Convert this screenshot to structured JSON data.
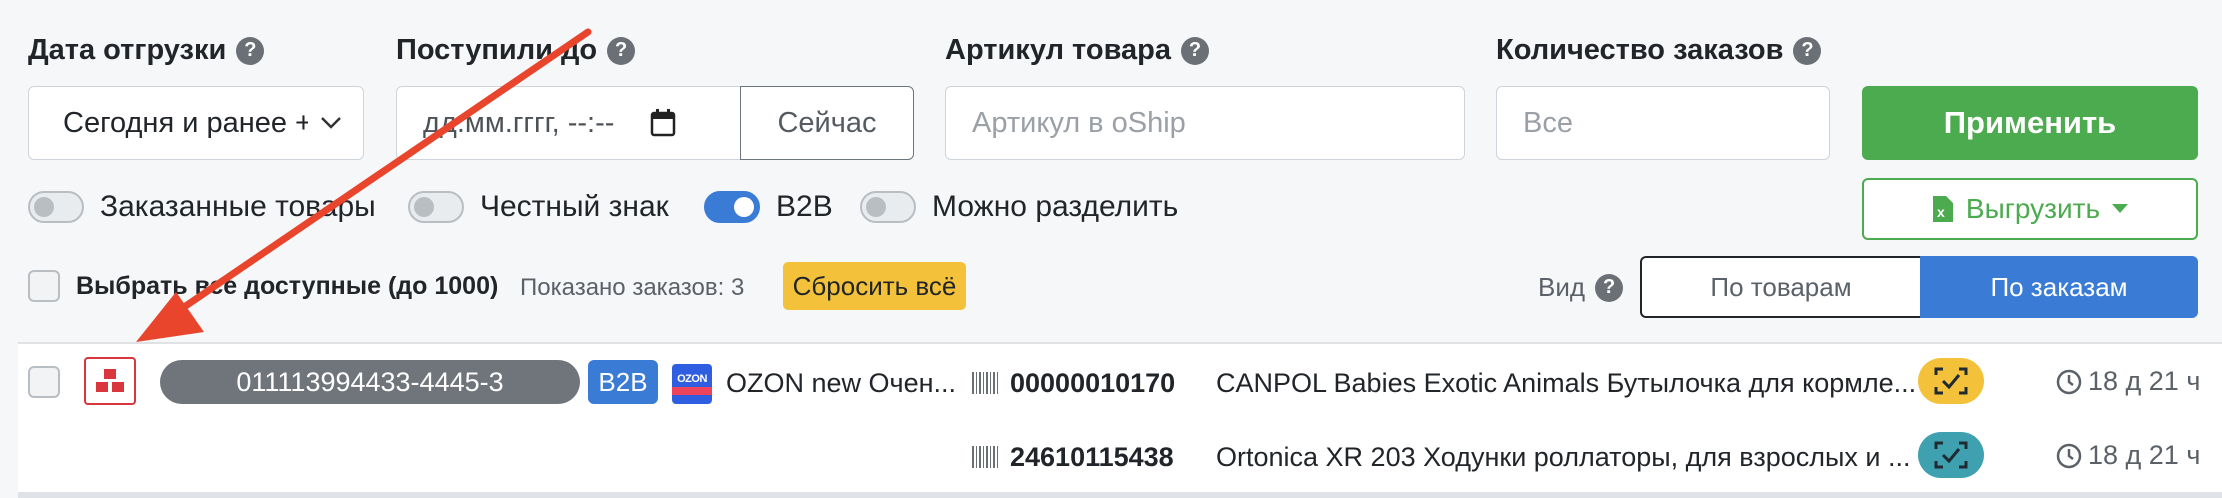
{
  "filters": {
    "ship_date": {
      "label": "Дата отгрузки",
      "value": "Сегодня и ранее +"
    },
    "received_until": {
      "label": "Поступили до",
      "placeholder": "дд.мм.гггг, --:--",
      "now_button": "Сейчас"
    },
    "article": {
      "label": "Артикул товара",
      "placeholder": "Артикул в oShip"
    },
    "order_count": {
      "label": "Количество заказов",
      "placeholder": "Все"
    },
    "apply_button": "Применить",
    "export_button": "Выгрузить"
  },
  "toggles": [
    {
      "label": "Заказанные товары",
      "on": false
    },
    {
      "label": "Честный знак",
      "on": false
    },
    {
      "label": "B2B",
      "on": true
    },
    {
      "label": "Можно разделить",
      "on": false
    }
  ],
  "selection": {
    "select_all_label": "Выбрать все доступные (до 1000)",
    "shown_count": "Показано заказов: 3",
    "reset_button": "Сбросить всё"
  },
  "view": {
    "label": "Вид",
    "by_products": "По товарам",
    "by_orders": "По заказам",
    "active": "По заказам"
  },
  "order": {
    "number": "011113994433-4445-3",
    "badge": "B2B",
    "marketplace": "OZON new Очен...",
    "marketplace_logo_text": "OZON",
    "items": [
      {
        "barcode": "00000010170",
        "title": "CANPOL Babies Exotic Animals Бутылочка для кормле...",
        "time": "18 д 21 ч",
        "status_color": "#f4c23a"
      },
      {
        "barcode": "24610115438",
        "title": "Ortonica XR 203 Ходунки роллаторы, для взрослых и ...",
        "time": "18 д 21 ч",
        "status_color": "#3fa1b0"
      }
    ]
  },
  "colors": {
    "accent_blue": "#3a7bd5",
    "green": "#4caa4f",
    "yellow": "#f4c23a",
    "arrow_red": "#e8452c"
  }
}
